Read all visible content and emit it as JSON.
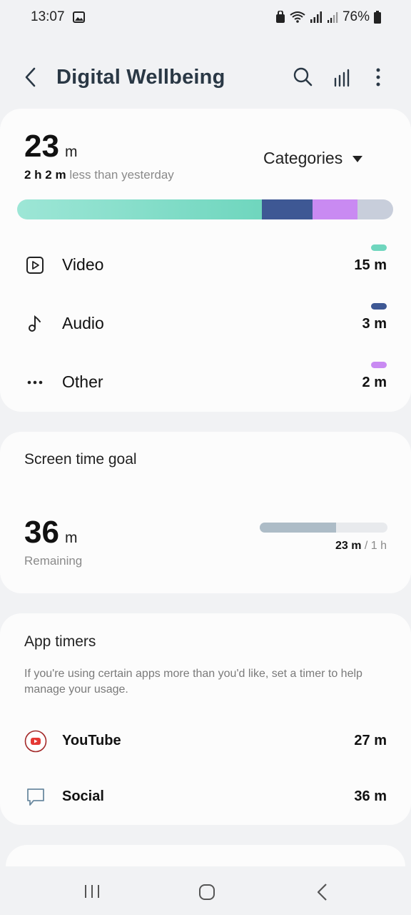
{
  "status_bar": {
    "time": "13:07",
    "battery": "76%"
  },
  "app_bar": {
    "title": "Digital Wellbeing"
  },
  "usage_card": {
    "total_value": "23",
    "total_unit": "m",
    "comparison_amount": "2 h 2 m",
    "comparison_text": " less than yesterday",
    "filter_label": "Categories",
    "bar_segments": [
      {
        "name": "Video",
        "fraction": 0.65,
        "color": "#6fd6be"
      },
      {
        "name": "Audio",
        "fraction": 0.135,
        "color": "#3e5894"
      },
      {
        "name": "Other",
        "fraction": 0.12,
        "color": "#c98af2"
      },
      {
        "name": "Remaining",
        "fraction": 0.095,
        "color": "#c8cedb"
      }
    ],
    "categories": [
      {
        "label": "Video",
        "value": "15 m",
        "color": "#6fd6be",
        "icon": "play-square-icon"
      },
      {
        "label": "Audio",
        "value": "3 m",
        "color": "#3e5894",
        "icon": "music-note-icon"
      },
      {
        "label": "Other",
        "value": "2 m",
        "color": "#c98af2",
        "icon": "more-horizontal-icon"
      }
    ]
  },
  "screen_time_goal": {
    "title": "Screen time goal",
    "remaining_value": "36",
    "remaining_unit": "m",
    "remaining_label": "Remaining",
    "used": "23 m",
    "goal": " / 1 h",
    "progress": 0.6
  },
  "app_timers": {
    "title": "App timers",
    "description": "If you're using certain apps more than you'd like, set a timer to help manage your usage.",
    "items": [
      {
        "label": "YouTube",
        "value": "27 m",
        "icon": "youtube-icon"
      },
      {
        "label": "Social",
        "value": "36 m",
        "icon": "chat-bubble-icon"
      }
    ]
  }
}
